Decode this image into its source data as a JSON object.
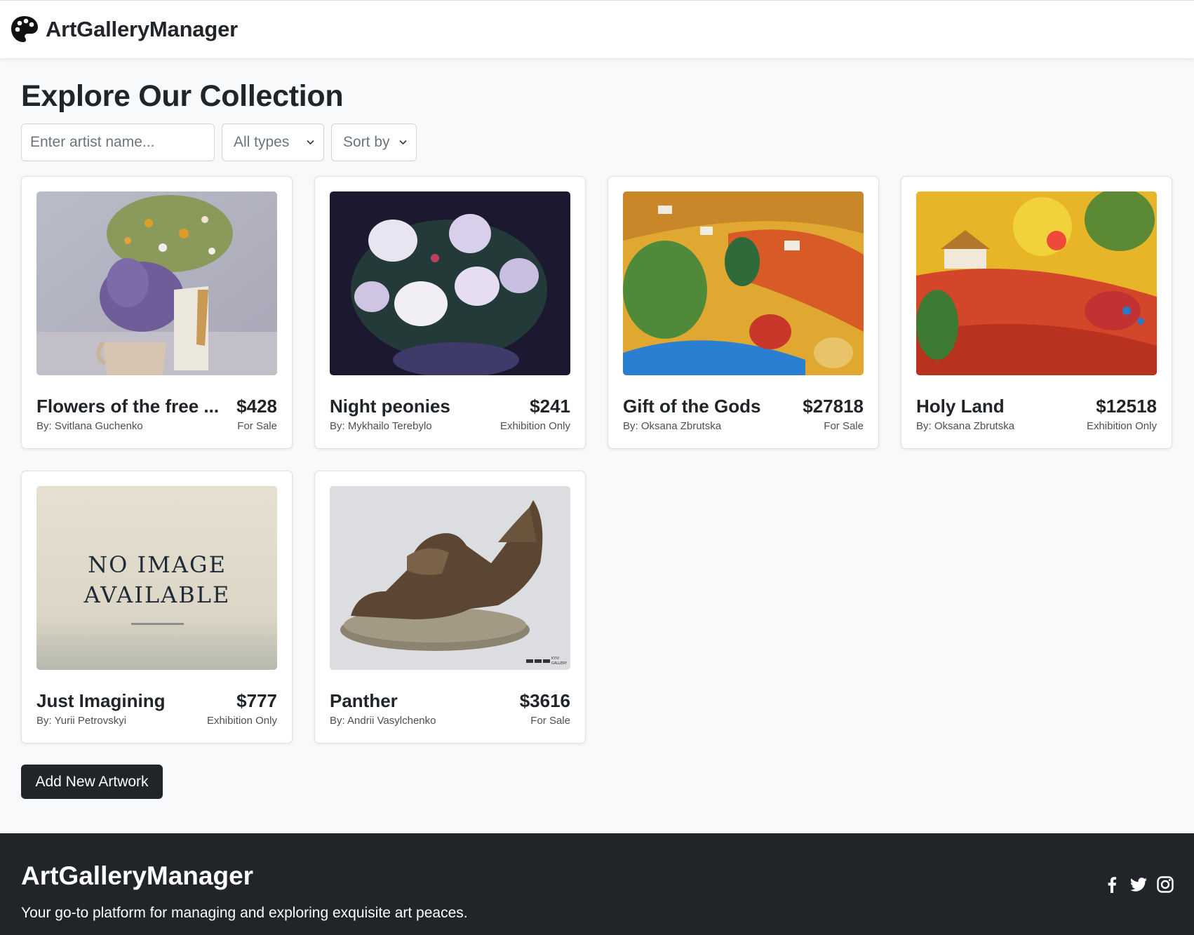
{
  "brand": {
    "name": "ArtGalleryManager",
    "logo_icon": "palette-icon"
  },
  "page": {
    "title": "Explore Our Collection"
  },
  "filters": {
    "artist_placeholder": "Enter artist name...",
    "type_select": "All types",
    "sort_select": "Sort by"
  },
  "artworks": [
    {
      "title": "Flowers of the free ...",
      "price": "$428",
      "artist": "By: Svitlana Guchenko",
      "status": "For Sale"
    },
    {
      "title": "Night peonies",
      "price": "$241",
      "artist": "By: Mykhailo Terebylo",
      "status": "Exhibition Only"
    },
    {
      "title": "Gift of the Gods",
      "price": "$27818",
      "artist": "By: Oksana Zbrutska",
      "status": "For Sale"
    },
    {
      "title": "Holy Land",
      "price": "$12518",
      "artist": "By: Oksana Zbrutska",
      "status": "Exhibition Only"
    },
    {
      "title": "Just Imagining",
      "price": "$777",
      "artist": "By: Yurii Petrovskyi",
      "status": "Exhibition Only",
      "image_text": [
        "NO IMAGE",
        "AVAILABLE"
      ]
    },
    {
      "title": "Panther",
      "price": "$3616",
      "artist": "By: Andrii Vasylchenko",
      "status": "For Sale",
      "watermark": [
        "KYIV",
        "GALLERY"
      ]
    }
  ],
  "add_button": "Add New Artwork",
  "footer": {
    "brand": "ArtGalleryManager",
    "tagline": "Your go-to platform for managing and exploring exquisite art peaces.",
    "social_icons": [
      "facebook-icon",
      "twitter-icon",
      "instagram-icon"
    ]
  },
  "colors": {
    "dark": "#212529",
    "page_bg": "#f8f9fa",
    "muted_text": "#6c757d",
    "border": "#dee2e6"
  }
}
